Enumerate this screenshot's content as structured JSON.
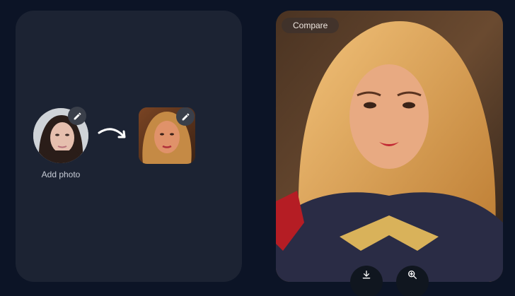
{
  "left_panel": {
    "add_photo_label": "Add photo"
  },
  "icons": {
    "source_edit": "pencil-icon",
    "target_edit": "pencil-icon",
    "arrow": "curved-arrow-icon",
    "download": "download-icon",
    "zoom": "zoom-in-icon"
  },
  "result": {
    "compare_label": "Compare"
  },
  "colors": {
    "background": "#0c1426",
    "panel": "#1c2333",
    "badge": "#3a3f4a"
  }
}
